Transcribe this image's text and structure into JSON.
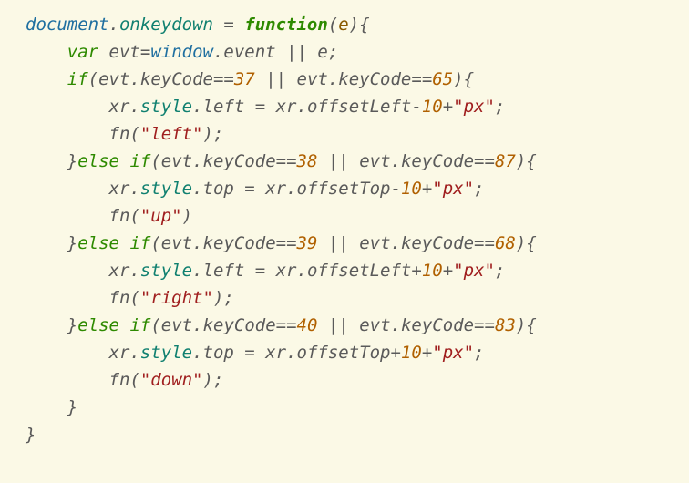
{
  "code": {
    "obj_document": "document",
    "prop_onkeydown": "onkeydown",
    "assign": " = ",
    "kw_function": "function",
    "param_e": "e",
    "brace_open": "{",
    "brace_close": "}",
    "kw_var": "var",
    "id_evt": "evt",
    "eq": "=",
    "obj_window": "window",
    "prop_event": "event",
    "op_or": " || ",
    "id_e": "e",
    "semi": ";",
    "kw_if": "if",
    "kw_else": "else",
    "dot": ".",
    "paren_open": "(",
    "paren_close": ")",
    "prop_keyCode": "keyCode",
    "op_eqeq": "==",
    "num_37": "37",
    "num_65": "65",
    "num_38": "38",
    "num_87": "87",
    "num_39": "39",
    "num_68": "68",
    "num_40": "40",
    "num_83": "83",
    "id_xr": "xr",
    "prop_style": "style",
    "prop_left": "left",
    "prop_top": "top",
    "prop_offsetLeft": "offsetLeft",
    "prop_offsetTop": "offsetTop",
    "op_minus": "-",
    "op_plus": "+",
    "num_10": "10",
    "str_px": "\"px\"",
    "id_fn": "fn",
    "str_left": "\"left\"",
    "str_up": "\"up\"",
    "str_right": "\"right\"",
    "str_down": "\"down\"",
    "indent1": "    ",
    "indent2": "        ",
    "sp": " "
  }
}
